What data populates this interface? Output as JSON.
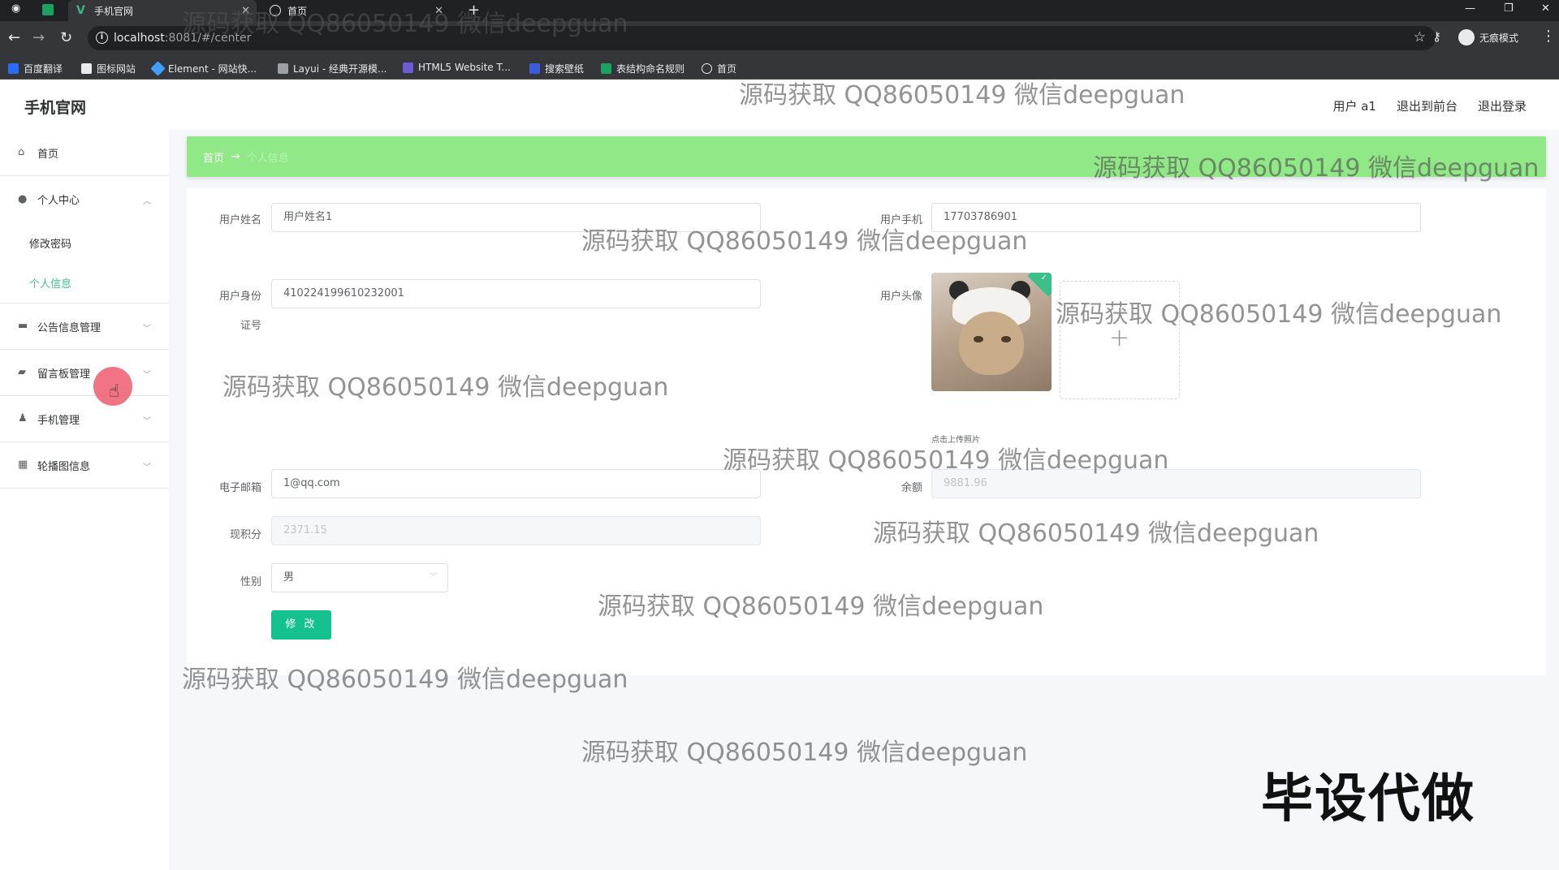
{
  "browser": {
    "tabs": [
      {
        "title": "手机官网",
        "active": true
      },
      {
        "title": "首页",
        "active": false
      }
    ],
    "url_host": "localhost",
    "url_rest": ":8081/#/center",
    "incognito_label": "无痕模式",
    "bookmarks": [
      "百度翻译",
      "图标网站",
      "Element - 网站快...",
      "Layui - 经典开源模...",
      "HTML5 Website T...",
      "搜索壁纸",
      "表结构命名规则",
      "首页"
    ]
  },
  "header": {
    "title": "手机官网",
    "user": "用户 a1",
    "back_to_front": "退出到前台",
    "logout": "退出登录"
  },
  "sidebar": {
    "home": "首页",
    "personal_center": "个人中心",
    "change_password": "修改密码",
    "personal_info": "个人信息",
    "notice_mgmt": "公告信息管理",
    "message_mgmt": "留言板管理",
    "phone_mgmt": "手机管理",
    "carousel_info": "轮播图信息"
  },
  "breadcrumb": {
    "home": "首页",
    "separator": "→",
    "current": "个人信息"
  },
  "form": {
    "name_label": "用户姓名",
    "name_value": "用户姓名1",
    "phone_label": "用户手机",
    "phone_value": "17703786901",
    "id_label_line1": "用户身份",
    "id_label_line2": "证号",
    "id_value": "410224199610232001",
    "avatar_label": "用户头像",
    "upload_hint": "点击上传照片",
    "email_label": "电子邮箱",
    "email_value": "1@qq.com",
    "balance_label": "余额",
    "balance_value": "9881.96",
    "points_label": "现积分",
    "points_value": "2371.15",
    "gender_label": "性别",
    "gender_value": "男",
    "submit_label": "修 改"
  },
  "watermark": {
    "text": "源码获取 QQ86050149 微信deepguan",
    "corner": "毕设代做"
  },
  "colors": {
    "accent": "#3cc08a",
    "breadcrumb_bg": "#90e886",
    "submit_bg": "#15c18e",
    "cursor_dot": "#eb465a"
  }
}
